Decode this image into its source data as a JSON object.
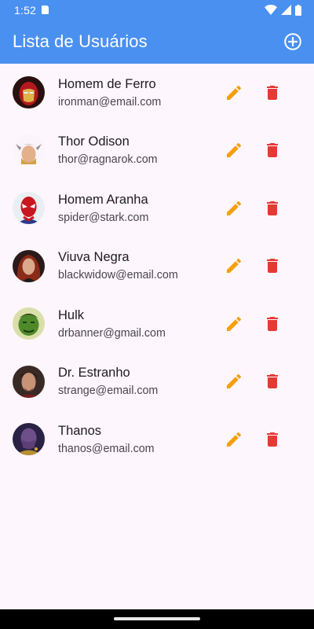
{
  "status_bar": {
    "time": "1:52",
    "icons": [
      "sim-icon",
      "wifi-icon",
      "signal-icon",
      "battery-icon"
    ]
  },
  "app_bar": {
    "title": "Lista de Usuários",
    "action_icon": "add-circle-icon",
    "background": "#4a90f0"
  },
  "users": [
    {
      "name": "Homem de Ferro",
      "email": "ironman@email.com",
      "avatar": "iron-man"
    },
    {
      "name": "Thor Odison",
      "email": "thor@ragnarok.com",
      "avatar": "thor"
    },
    {
      "name": "Homem Aranha",
      "email": "spider@stark.com",
      "avatar": "spider-man"
    },
    {
      "name": "Viuva Negra",
      "email": "blackwidow@email.com",
      "avatar": "black-widow"
    },
    {
      "name": "Hulk",
      "email": "drbanner@gmail.com",
      "avatar": "hulk"
    },
    {
      "name": "Dr. Estranho",
      "email": "strange@email.com",
      "avatar": "doctor-strange"
    },
    {
      "name": "Thanos",
      "email": "thanos@email.com",
      "avatar": "thanos"
    }
  ],
  "row_actions": {
    "edit_icon": "pencil-icon",
    "edit_color": "#f59f0b",
    "delete_icon": "trash-icon",
    "delete_color": "#e53935"
  }
}
